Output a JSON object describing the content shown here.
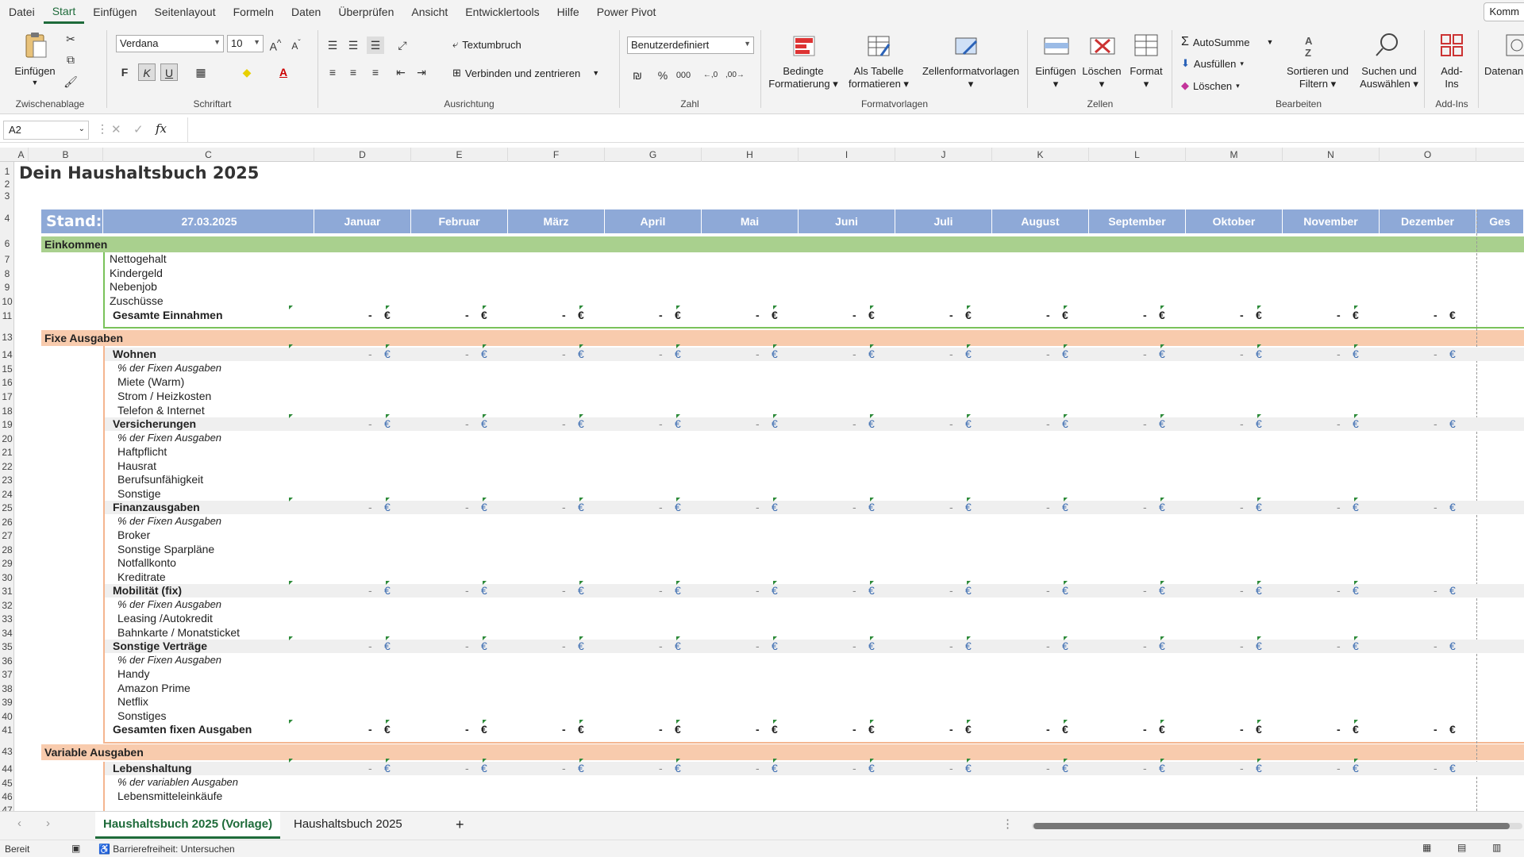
{
  "menu": {
    "items": [
      "Datei",
      "Start",
      "Einfügen",
      "Seitenlayout",
      "Formeln",
      "Daten",
      "Überprüfen",
      "Ansicht",
      "Entwicklertools",
      "Hilfe",
      "Power Pivot"
    ],
    "comment_btn": "Komm"
  },
  "ribbon": {
    "paste": "Einfügen",
    "clipboard_group": "Zwischenablage",
    "font_name": "Verdana",
    "font_size": "10",
    "font_group": "Schriftart",
    "bold": "F",
    "italic": "K",
    "underline": "U",
    "wrap": "Textumbruch",
    "merge": "Verbinden und zentrieren",
    "align_group": "Ausrichtung",
    "number_format": "Benutzerdefiniert",
    "number_group": "Zahl",
    "cond_format_l1": "Bedingte",
    "cond_format_l2": "Formatierung",
    "as_table_l1": "Als Tabelle",
    "as_table_l2": "formatieren",
    "cell_styles": "Zellenformatvorlagen",
    "styles_group": "Formatvorlagen",
    "insert": "Einfügen",
    "delete": "Löschen",
    "format": "Format",
    "cells_group": "Zellen",
    "autosum": "AutoSumme",
    "fill": "Ausfüllen",
    "clear": "Löschen",
    "sort_l1": "Sortieren und",
    "sort_l2": "Filtern",
    "find_l1": "Suchen und",
    "find_l2": "Auswählen",
    "edit_group": "Bearbeiten",
    "addins_l1": "Add-",
    "addins_l2": "Ins",
    "addins_group": "Add-Ins",
    "data_analysis": "Datenan"
  },
  "formula_bar": {
    "name_box": "A2",
    "fx": "fx",
    "value": ""
  },
  "columns": [
    "A",
    "B",
    "C",
    "D",
    "E",
    "F",
    "G",
    "H",
    "I",
    "J",
    "K",
    "L",
    "M",
    "N",
    "O"
  ],
  "sheet": {
    "title": "Dein Haushaltsbuch 2025",
    "stand_label": "Stand:",
    "stand_date": "27.03.2025",
    "months": [
      "Januar",
      "Februar",
      "März",
      "April",
      "Mai",
      "Juni",
      "Juli",
      "August",
      "September",
      "Oktober",
      "November",
      "Dezember"
    ],
    "total_col": "Ges",
    "sections": {
      "income": "Einkommen",
      "fixed": "Fixe Ausgaben",
      "variable": "Variable Ausgaben"
    },
    "rows": [
      {
        "r": "7",
        "label": "Nettogehalt",
        "type": "item1"
      },
      {
        "r": "8",
        "label": "Kindergeld",
        "type": "item1"
      },
      {
        "r": "9",
        "label": "Nebenjob",
        "type": "item1"
      },
      {
        "r": "10",
        "label": "Zuschüsse",
        "type": "item1"
      },
      {
        "r": "11",
        "label": "Gesamte Einnahmen",
        "type": "total"
      },
      {
        "r": "14",
        "label": "Wohnen",
        "type": "cat"
      },
      {
        "r": "15",
        "label": "% der Fixen Ausgaben",
        "type": "pct"
      },
      {
        "r": "16",
        "label": "Miete (Warm)",
        "type": "item"
      },
      {
        "r": "17",
        "label": "Strom / Heizkosten",
        "type": "item"
      },
      {
        "r": "18",
        "label": "Telefon & Internet",
        "type": "item"
      },
      {
        "r": "19",
        "label": "Versicherungen",
        "type": "cat"
      },
      {
        "r": "20",
        "label": "% der Fixen Ausgaben",
        "type": "pct"
      },
      {
        "r": "21",
        "label": "Haftpflicht",
        "type": "item"
      },
      {
        "r": "22",
        "label": "Hausrat",
        "type": "item"
      },
      {
        "r": "23",
        "label": "Berufsunfähigkeit",
        "type": "item"
      },
      {
        "r": "24",
        "label": "Sonstige",
        "type": "item"
      },
      {
        "r": "25",
        "label": "Finanzausgaben",
        "type": "cat"
      },
      {
        "r": "26",
        "label": "% der Fixen Ausgaben",
        "type": "pct"
      },
      {
        "r": "27",
        "label": "Broker",
        "type": "item"
      },
      {
        "r": "28",
        "label": "Sonstige Sparpläne",
        "type": "item"
      },
      {
        "r": "29",
        "label": "Notfallkonto",
        "type": "item"
      },
      {
        "r": "30",
        "label": "Kreditrate",
        "type": "item"
      },
      {
        "r": "31",
        "label": "Mobilität (fix)",
        "type": "cat"
      },
      {
        "r": "32",
        "label": "% der Fixen Ausgaben",
        "type": "pct"
      },
      {
        "r": "33",
        "label": "Leasing /Autokredit",
        "type": "item"
      },
      {
        "r": "34",
        "label": "Bahnkarte / Monatsticket",
        "type": "item"
      },
      {
        "r": "35",
        "label": "Sonstige Verträge",
        "type": "cat"
      },
      {
        "r": "36",
        "label": "% der Fixen Ausgaben",
        "type": "pct"
      },
      {
        "r": "37",
        "label": "Handy",
        "type": "item"
      },
      {
        "r": "38",
        "label": "Amazon Prime",
        "type": "item"
      },
      {
        "r": "39",
        "label": "Netflix",
        "type": "item"
      },
      {
        "r": "40",
        "label": "Sonstiges",
        "type": "item"
      },
      {
        "r": "41",
        "label": "Gesamten fixen Ausgaben",
        "type": "total"
      },
      {
        "r": "44",
        "label": "Lebenshaltung",
        "type": "cat"
      },
      {
        "r": "45",
        "label": "% der variablen Ausgaben",
        "type": "pct"
      },
      {
        "r": "46",
        "label": "Lebensmitteleinkäufe",
        "type": "item"
      }
    ],
    "dash": "-",
    "euro": "€"
  },
  "tabs": {
    "t1": "Haushaltsbuch 2025 (Vorlage)",
    "t2": "Haushaltsbuch 2025",
    "add": "+"
  },
  "status": {
    "ready": "Bereit",
    "access": "Barrierefreiheit: Untersuchen"
  },
  "colors": {
    "header": "#8ea9d7",
    "income": "#a9d08e",
    "expense": "#f8cbad",
    "accent": "#1e6b3a"
  }
}
